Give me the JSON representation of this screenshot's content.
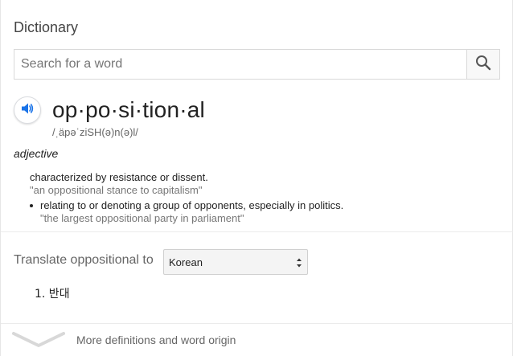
{
  "section_title": "Dictionary",
  "search": {
    "placeholder": "Search for a word",
    "value": "",
    "icon": "search-icon"
  },
  "entry": {
    "headword": "op·po·si·tion·al",
    "phonetic": "/ˌäpəˈziSH(ə)n(ə)l/",
    "audio_icon": "speaker-icon",
    "part_of_speech": "adjective",
    "definitions": [
      {
        "text": "characterized by resistance or dissent.",
        "example": "\"an oppositional stance to capitalism\""
      }
    ],
    "sub_definitions": [
      {
        "text": "relating to or denoting a group of opponents, especially in politics.",
        "example": "\"the largest oppositional party in parliament\""
      }
    ]
  },
  "translate": {
    "label": "Translate oppositional to",
    "selected_language": "Korean",
    "results": [
      "1. 반대"
    ]
  },
  "footer": {
    "more_label": "More definitions and word origin",
    "expand_icon": "chevron-down-icon"
  },
  "colors": {
    "accent": "#1a73e8",
    "muted_text": "#666666",
    "example_text": "#777777",
    "border": "#d9d9d9"
  }
}
